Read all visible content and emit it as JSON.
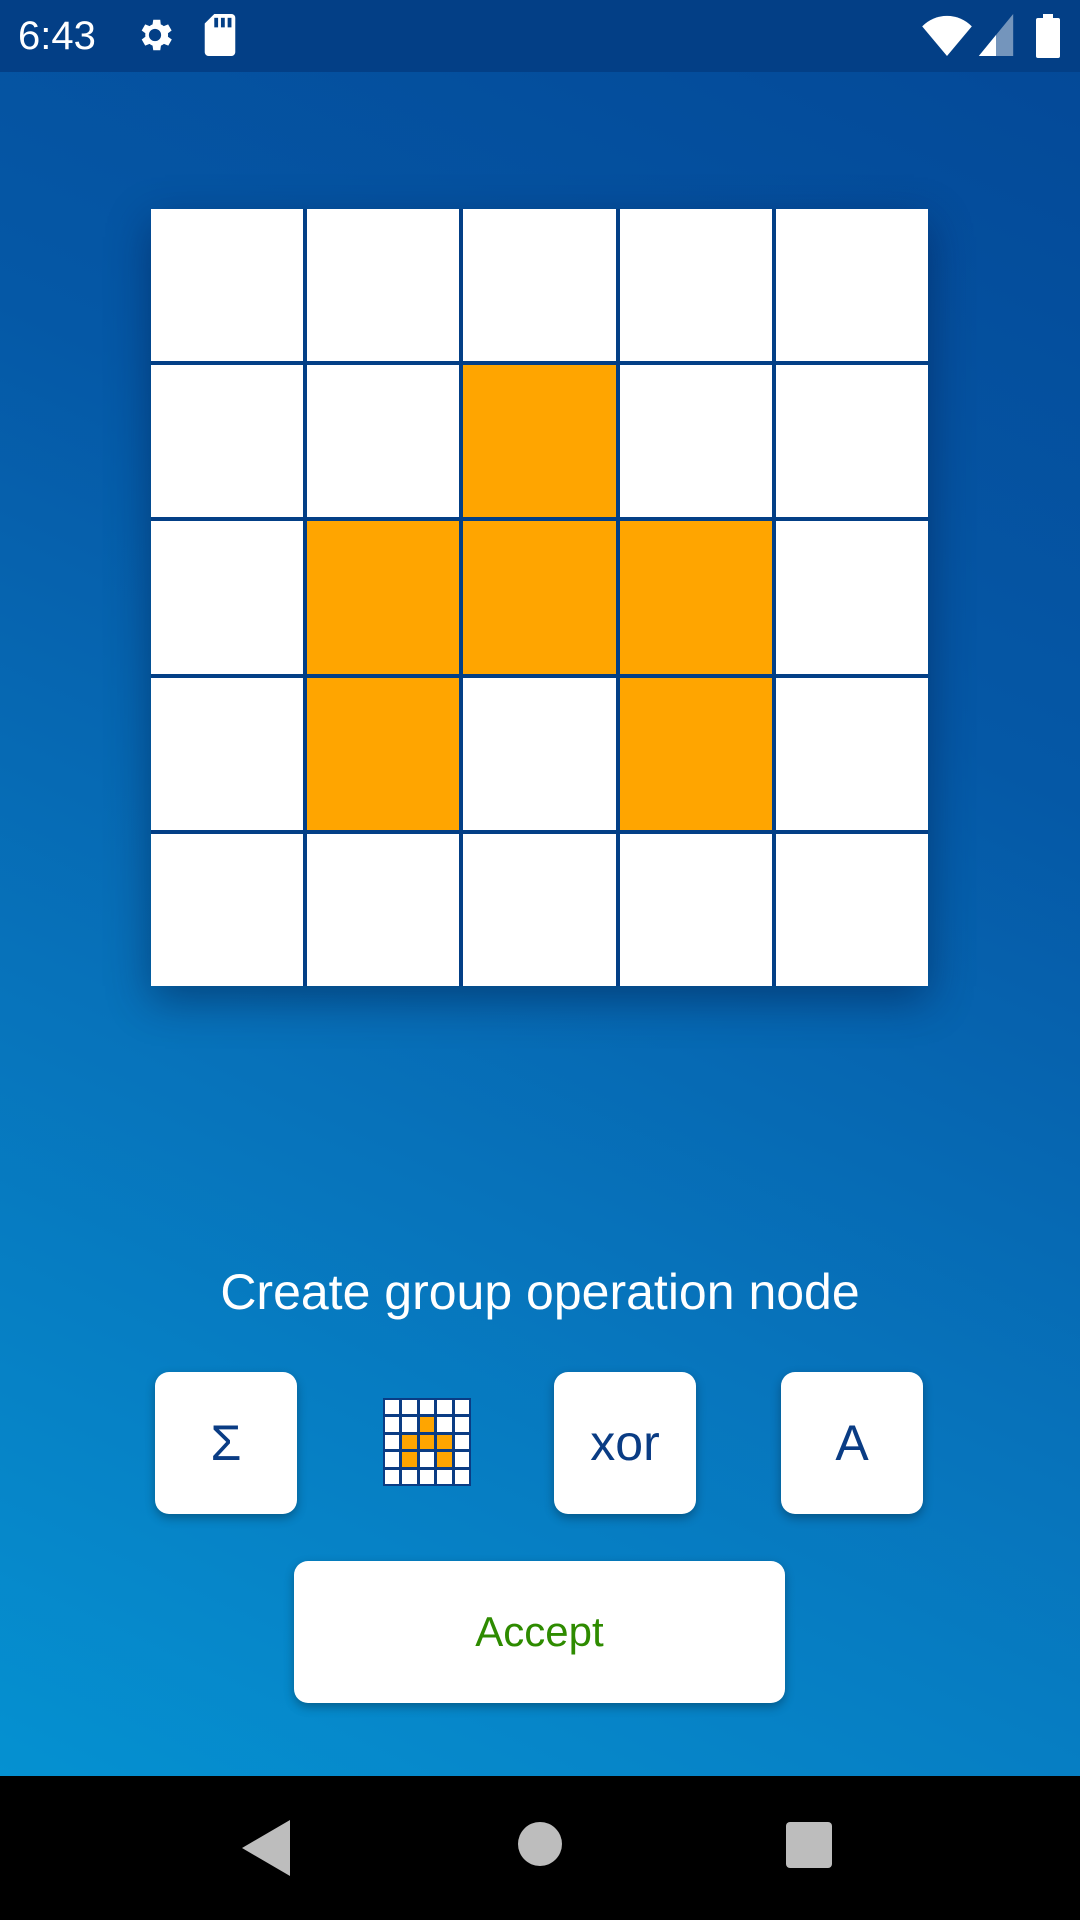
{
  "status_bar": {
    "time": "6:43",
    "icons": [
      "settings-icon",
      "sd-card-icon",
      "wifi-icon",
      "cell-signal-icon",
      "battery-icon"
    ]
  },
  "grid": {
    "rows": 5,
    "cols": 5,
    "cells": [
      [
        0,
        0,
        0,
        0,
        0
      ],
      [
        0,
        0,
        1,
        0,
        0
      ],
      [
        0,
        1,
        1,
        1,
        0
      ],
      [
        0,
        1,
        0,
        1,
        0
      ],
      [
        0,
        0,
        0,
        0,
        0
      ]
    ],
    "on_color": "#ffa500",
    "off_color": "#ffffff"
  },
  "caption": "Create group operation node",
  "operations": {
    "sum_label": "Σ",
    "xor_label": "xor",
    "a_label": "A",
    "pattern_icon": "grid-pattern-icon"
  },
  "accept_label": "Accept",
  "colors": {
    "accent": "#ffa500",
    "primary_dark": "#033f86",
    "accept_text": "#2e8b00",
    "button_text": "#0a3c84"
  },
  "nav": [
    "back-icon",
    "home-icon",
    "recents-icon"
  ]
}
